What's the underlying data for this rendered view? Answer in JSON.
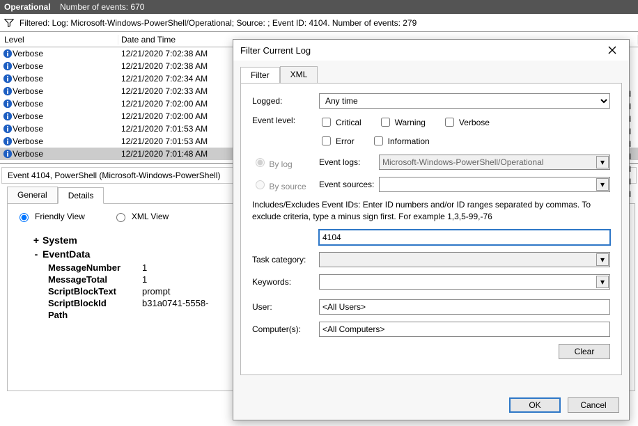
{
  "header": {
    "title": "Operational",
    "subtitle": "Number of events: 670"
  },
  "filterbar": {
    "text": "Filtered: Log: Microsoft-Windows-PowerShell/Operational; Source: ; Event ID: 4104. Number of events: 279"
  },
  "columns": {
    "level": "Level",
    "date": "Date and Time"
  },
  "rows": [
    {
      "level": "Verbose",
      "date": "12/21/2020 7:02:38 AM",
      "tail": "nand",
      "sel": false
    },
    {
      "level": "Verbose",
      "date": "12/21/2020 7:02:38 AM",
      "tail": "nand",
      "sel": false
    },
    {
      "level": "Verbose",
      "date": "12/21/2020 7:02:34 AM",
      "tail": "nand",
      "sel": false
    },
    {
      "level": "Verbose",
      "date": "12/21/2020 7:02:33 AM",
      "tail": "nand",
      "sel": false
    },
    {
      "level": "Verbose",
      "date": "12/21/2020 7:02:00 AM",
      "tail": "nand",
      "sel": false
    },
    {
      "level": "Verbose",
      "date": "12/21/2020 7:02:00 AM",
      "tail": "nand",
      "sel": false
    },
    {
      "level": "Verbose",
      "date": "12/21/2020 7:01:53 AM",
      "tail": "nand",
      "sel": false
    },
    {
      "level": "Verbose",
      "date": "12/21/2020 7:01:53 AM",
      "tail": "nand",
      "sel": false
    },
    {
      "level": "Verbose",
      "date": "12/21/2020 7:01:48 AM",
      "tail": "nand",
      "sel": true
    }
  ],
  "event_title": "Event 4104, PowerShell (Microsoft-Windows-PowerShell)",
  "detail_tabs": {
    "general": "General",
    "details": "Details"
  },
  "view_radios": {
    "friendly": "Friendly View",
    "xml": "XML View"
  },
  "tree": {
    "system": "System",
    "eventdata": "EventData",
    "items": [
      {
        "k": "MessageNumber",
        "v": "1"
      },
      {
        "k": "MessageTotal",
        "v": "1"
      },
      {
        "k": "ScriptBlockText",
        "v": "prompt"
      },
      {
        "k": "ScriptBlockId",
        "v": "b31a0741-5558-"
      },
      {
        "k": "Path",
        "v": ""
      }
    ]
  },
  "dialog": {
    "title": "Filter Current Log",
    "tabs": {
      "filter": "Filter",
      "xml": "XML"
    },
    "labels": {
      "logged": "Logged:",
      "event_level": "Event level:",
      "by_log": "By log",
      "by_source": "By source",
      "event_logs": "Event logs:",
      "event_sources": "Event sources:",
      "task_category": "Task category:",
      "keywords": "Keywords:",
      "user": "User:",
      "computers": "Computer(s):"
    },
    "logged_value": "Any time",
    "levels": {
      "critical": "Critical",
      "warning": "Warning",
      "verbose": "Verbose",
      "error": "Error",
      "information": "Information"
    },
    "event_logs_value": "Microsoft-Windows-PowerShell/Operational",
    "hint": "Includes/Excludes Event IDs: Enter ID numbers and/or ID ranges separated by commas. To exclude criteria, type a minus sign first. For example 1,3,5-99,-76",
    "event_id_value": "4104",
    "user_value": "<All Users>",
    "computers_value": "<All Computers>",
    "buttons": {
      "clear": "Clear",
      "ok": "OK",
      "cancel": "Cancel"
    }
  }
}
